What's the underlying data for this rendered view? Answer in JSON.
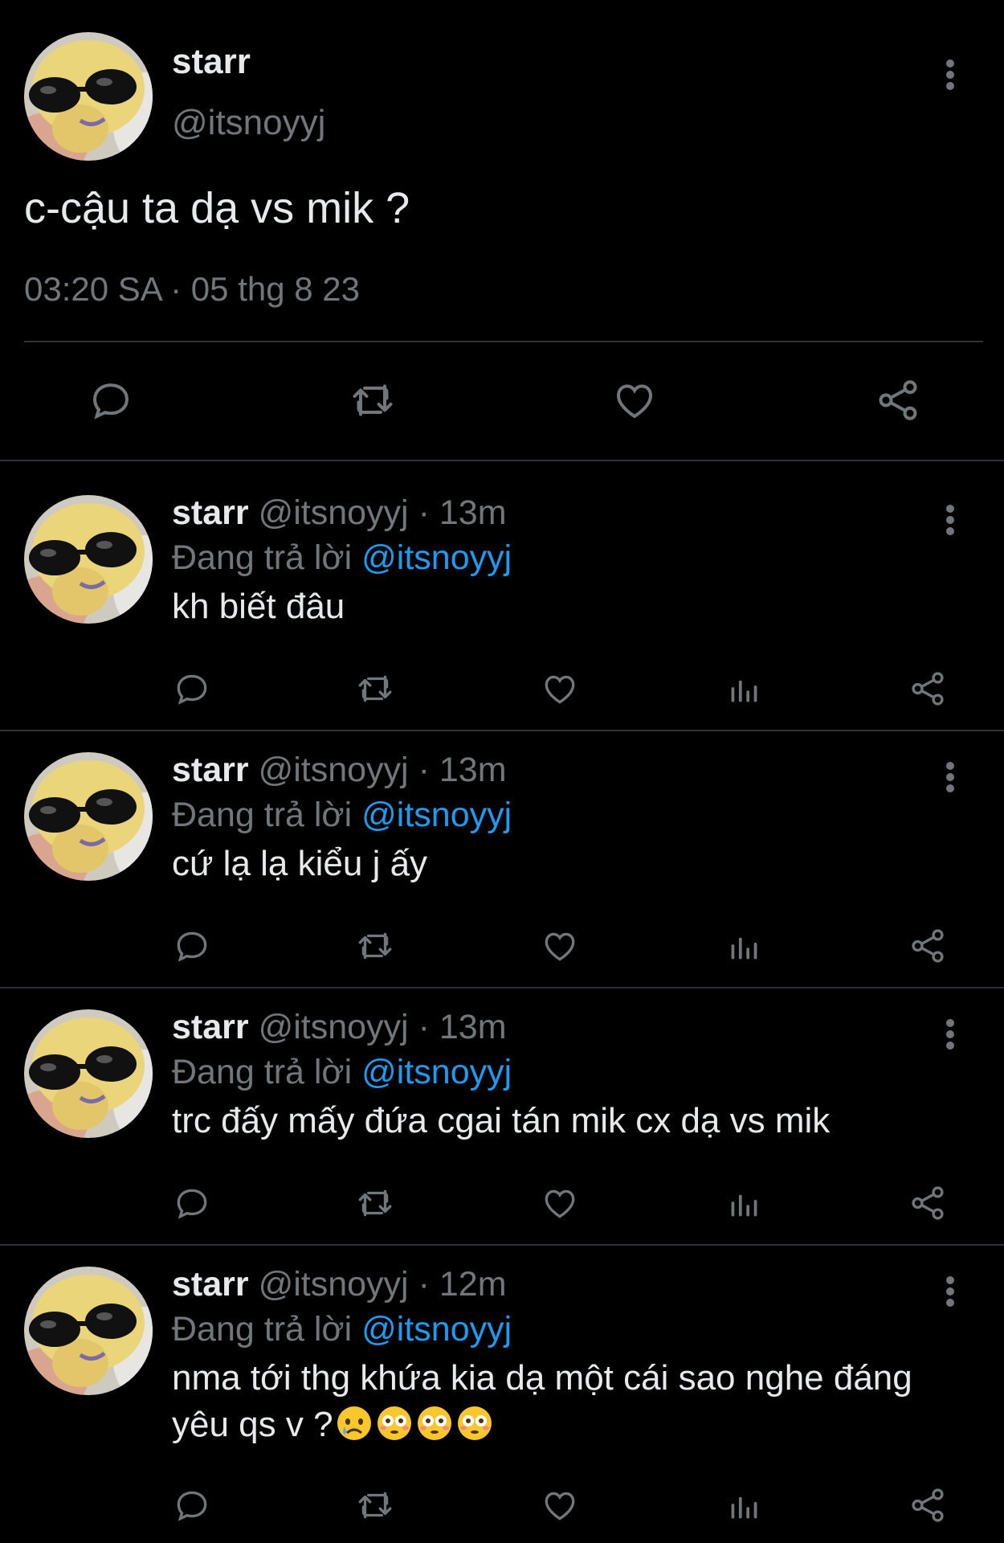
{
  "main_tweet": {
    "display_name": "starr",
    "handle": "@itsnoyyj",
    "text": "c-cậu ta dạ vs mik ?",
    "timestamp": "03:20 SA · 05 thg 8 23",
    "actions": [
      "reply-icon",
      "retweet-icon",
      "like-icon",
      "share-icon"
    ]
  },
  "replies": [
    {
      "display_name": "starr",
      "handle": "@itsnoyyj",
      "separator": "·",
      "time": "13m",
      "replying_prefix": "Đang trả lời",
      "replying_to": "@itsnoyyj",
      "text": "kh biết đâu"
    },
    {
      "display_name": "starr",
      "handle": "@itsnoyyj",
      "separator": "·",
      "time": "13m",
      "replying_prefix": "Đang trả lời",
      "replying_to": "@itsnoyyj",
      "text": "cứ lạ lạ kiểu j ấy"
    },
    {
      "display_name": "starr",
      "handle": "@itsnoyyj",
      "separator": "·",
      "time": "13m",
      "replying_prefix": "Đang trả lời",
      "replying_to": "@itsnoyyj",
      "text": "trc đấy mấy đứa cgai tán mik cx dạ vs mik"
    },
    {
      "display_name": "starr",
      "handle": "@itsnoyyj",
      "separator": "·",
      "time": "12m",
      "replying_prefix": "Đang trả lời",
      "replying_to": "@itsnoyyj",
      "text": "nma tới thg khứa kia dạ một cái sao nghe đáng yêu qs v ?",
      "emojis": [
        "sad-tear-emoji",
        "flushed-emoji",
        "flushed-emoji",
        "flushed-emoji"
      ]
    }
  ],
  "colors": {
    "background": "#000000",
    "text": "#e7e9ea",
    "muted": "#71767b",
    "link": "#1d9bf0",
    "divider": "#2f3336"
  }
}
